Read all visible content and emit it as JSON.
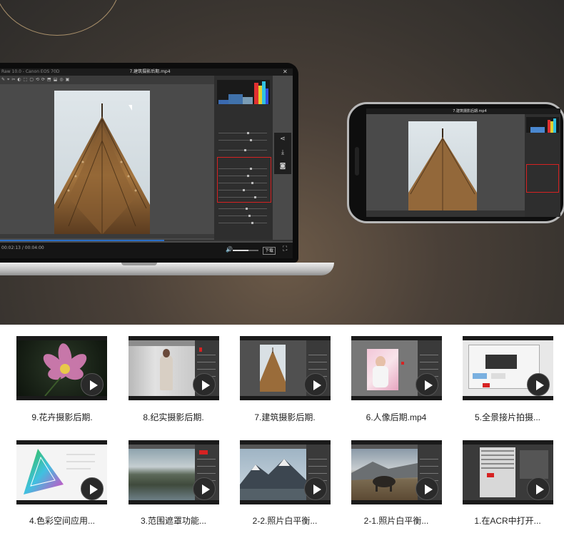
{
  "laptop": {
    "window_title": "7.建筑摄影后期.mp4",
    "left_title": "Raw 10.0 - Canon EOS 70D",
    "time": "00:02:13 / 00:04:00",
    "download_label": "下载",
    "fullscreen_icon": "fullscreen-icon",
    "close_icon": "close-icon",
    "progress": 0.56,
    "volume": 0.6,
    "side_icons": [
      "share-icon",
      "download-icon",
      "screenshot-icon"
    ]
  },
  "phone": {
    "window_title": "7.建筑摄影后期.mp4"
  },
  "thumbnails": [
    {
      "caption": "9.花卉摄影后期."
    },
    {
      "caption": "8.纪实摄影后期."
    },
    {
      "caption": "7.建筑摄影后期."
    },
    {
      "caption": "6.人像后期.mp4"
    },
    {
      "caption": "5.全景接片拍摄..."
    },
    {
      "caption": "4.色彩空间应用..."
    },
    {
      "caption": "3.范围遮罩功能..."
    },
    {
      "caption": "2-2.照片白平衡..."
    },
    {
      "caption": "2-1.照片白平衡..."
    },
    {
      "caption": "1.在ACR中打开..."
    }
  ],
  "colors": {
    "accent_red": "#d62222",
    "progress_blue": "#2a6fc7"
  }
}
